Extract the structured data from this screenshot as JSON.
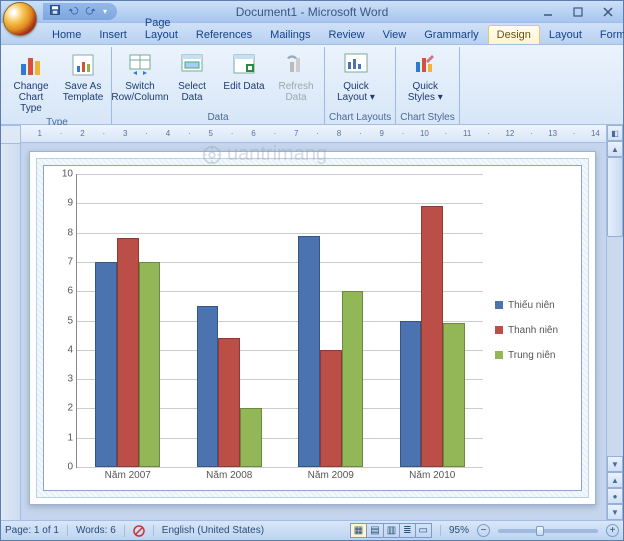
{
  "window": {
    "title": "Document1 - Microsoft Word"
  },
  "tabs": {
    "items": [
      {
        "label": "Home"
      },
      {
        "label": "Insert"
      },
      {
        "label": "Page Layout"
      },
      {
        "label": "References"
      },
      {
        "label": "Mailings"
      },
      {
        "label": "Review"
      },
      {
        "label": "View"
      },
      {
        "label": "Grammarly"
      },
      {
        "label": "Design"
      },
      {
        "label": "Layout"
      },
      {
        "label": "Format"
      }
    ],
    "selected_index": 8
  },
  "ribbon": {
    "groups": {
      "type": {
        "label": "Type",
        "change_chart_type": "Change Chart Type",
        "save_as_template": "Save As Template"
      },
      "data": {
        "label": "Data",
        "switch_row_col": "Switch Row/Column",
        "select_data": "Select Data",
        "edit_data": "Edit Data",
        "refresh_data": "Refresh Data"
      },
      "chart_layouts": {
        "label": "Chart Layouts",
        "quick_layout": "Quick Layout"
      },
      "chart_styles": {
        "label": "Chart Styles",
        "quick_styles": "Quick Styles"
      }
    }
  },
  "status": {
    "page": "Page: 1 of 1",
    "words": "Words: 6",
    "language": "English (United States)",
    "zoom": "95%"
  },
  "chart_data": {
    "type": "bar",
    "categories": [
      "Năm 2007",
      "Năm 2008",
      "Năm 2009",
      "Năm 2010"
    ],
    "series": [
      {
        "name": "Thiếu niên",
        "color": "#4a73b0",
        "values": [
          7.0,
          5.5,
          7.9,
          5.0
        ]
      },
      {
        "name": "Thanh niên",
        "color": "#bb4f48",
        "values": [
          7.8,
          4.4,
          4.0,
          8.9
        ]
      },
      {
        "name": "Trung niên",
        "color": "#92b756",
        "values": [
          7.0,
          2.0,
          6.0,
          4.9
        ]
      }
    ],
    "ylim": [
      0,
      10
    ],
    "ytick_step": 1,
    "title": "",
    "xlabel": "",
    "ylabel": ""
  },
  "watermark_text": "uantrimang"
}
